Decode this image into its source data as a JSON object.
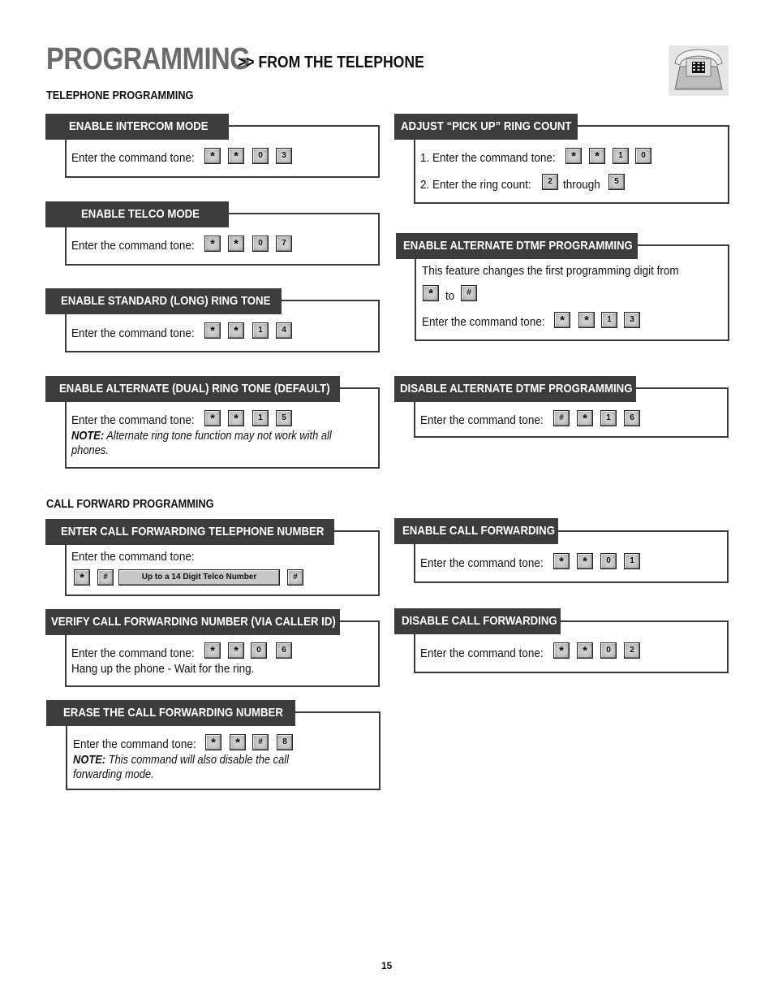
{
  "header": {
    "title": "PROGRAMMING",
    "subtitle": ">> FROM THE TELEPHONE",
    "icon": "telephone-icon"
  },
  "sections": {
    "telephone": "TELEPHONE PROGRAMMING",
    "call_forward": "CALL FORWARD PROGRAMMING"
  },
  "prompt": "Enter the command tone:",
  "boxes": {
    "intercom": {
      "title": "ENABLE INTERCOM MODE",
      "keys": [
        "*",
        "*",
        "0",
        "3"
      ]
    },
    "telco": {
      "title": "ENABLE TELCO MODE",
      "keys": [
        "*",
        "*",
        "0",
        "7"
      ]
    },
    "standard_ring": {
      "title": "ENABLE STANDARD (LONG) RING TONE",
      "keys": [
        "*",
        "*",
        "1",
        "4"
      ]
    },
    "alt_ring": {
      "title": "ENABLE ALTERNATE (DUAL) RING TONE (DEFAULT)",
      "keys": [
        "*",
        "*",
        "1",
        "5"
      ],
      "note_label": "NOTE:",
      "note_text": " Alternate ring tone function may not work with all phones."
    },
    "pickup": {
      "title": "ADJUST “PICK UP” RING COUNT",
      "step1": "1. Enter the command tone:",
      "keys": [
        "*",
        "*",
        "1",
        "0"
      ],
      "step2": "2. Enter the ring count:",
      "range_from": "2",
      "through": "through",
      "range_to": "5"
    },
    "enable_dtmf": {
      "title": "ENABLE ALTERNATE DTMF PROGRAMMING",
      "desc": "This feature changes the first programming digit from",
      "from_key": "*",
      "to": "to",
      "to_key": "#",
      "keys": [
        "*",
        "*",
        "1",
        "3"
      ]
    },
    "disable_dtmf": {
      "title": "DISABLE ALTERNATE DTMF PROGRAMMING",
      "keys": [
        "#",
        "*",
        "1",
        "6"
      ]
    },
    "enter_cf": {
      "title": "ENTER CALL FORWARDING TELEPHONE NUMBER",
      "keys": [
        "*",
        "#"
      ],
      "number_field": "Up to a 14 Digit Telco Number",
      "end_key": "#"
    },
    "verify_cf": {
      "title": "VERIFY CALL FORWARDING NUMBER (VIA CALLER ID)",
      "keys": [
        "*",
        "*",
        "0",
        "6"
      ],
      "after": "Hang up the phone - Wait for the ring."
    },
    "erase_cf": {
      "title": "ERASE THE CALL FORWARDING NUMBER",
      "keys": [
        "*",
        "*",
        "#",
        "8"
      ],
      "note_label": "NOTE:",
      "note_text": " This command will also disable the call forwarding mode."
    },
    "enable_cf": {
      "title": "ENABLE CALL FORWARDING",
      "keys": [
        "*",
        "*",
        "0",
        "1"
      ]
    },
    "disable_cf": {
      "title": "DISABLE CALL FORWARDING",
      "keys": [
        "*",
        "*",
        "0",
        "2"
      ]
    }
  },
  "page_number": "15"
}
